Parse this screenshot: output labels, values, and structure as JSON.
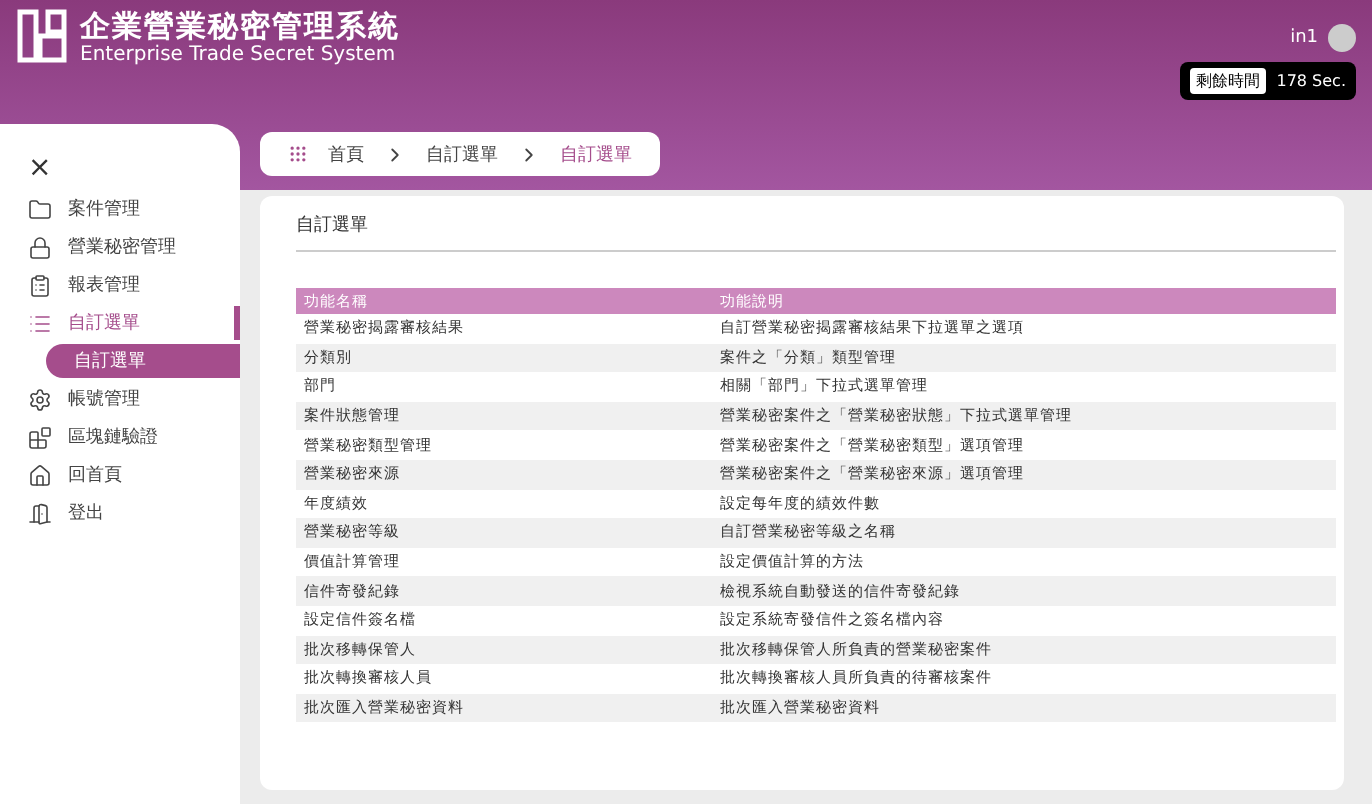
{
  "brand": {
    "title": "企業營業秘密管理系統",
    "subtitle": "Enterprise Trade Secret System"
  },
  "user": {
    "name": "in1",
    "timer_label": "剩餘時間",
    "timer_value": "178 Sec."
  },
  "sidebar": {
    "close": "×",
    "items": [
      {
        "label": "案件管理",
        "selected": false
      },
      {
        "label": "營業秘密管理",
        "selected": false
      },
      {
        "label": "報表管理",
        "selected": false
      },
      {
        "label": "自訂選單",
        "selected": true,
        "children": [
          {
            "label": "自訂選單",
            "selected": true
          }
        ]
      },
      {
        "label": "帳號管理",
        "selected": false
      },
      {
        "label": "區塊鏈驗證",
        "selected": false
      },
      {
        "label": "回首頁",
        "selected": false
      },
      {
        "label": "登出",
        "selected": false
      }
    ]
  },
  "breadcrumb": [
    {
      "label": "首頁",
      "selected": false
    },
    {
      "label": "自訂選單",
      "selected": false
    },
    {
      "label": "自訂選單",
      "selected": true
    }
  ],
  "panel": {
    "title": "自訂選單"
  },
  "table": {
    "columns": [
      "功能名稱",
      "功能說明"
    ],
    "rows": [
      [
        "營業秘密揭露審核結果",
        "自訂營業秘密揭露審核結果下拉選單之選項"
      ],
      [
        "分類別",
        "案件之「分類」類型管理"
      ],
      [
        "部門",
        "相關「部門」下拉式選單管理"
      ],
      [
        "案件狀態管理",
        "營業秘密案件之「營業秘密狀態」下拉式選單管理"
      ],
      [
        "營業秘密類型管理",
        "營業秘密案件之「營業秘密類型」選項管理"
      ],
      [
        "營業秘密來源",
        "營業秘密案件之「營業秘密來源」選項管理"
      ],
      [
        "年度績效",
        "設定每年度的績效件數"
      ],
      [
        "營業秘密等級",
        "自訂營業秘密等級之名稱"
      ],
      [
        "價值計算管理",
        "設定價值計算的方法"
      ],
      [
        "信件寄發紀錄",
        "檢視系統自動發送的信件寄發紀錄"
      ],
      [
        "設定信件簽名檔",
        "設定系統寄發信件之簽名檔內容"
      ],
      [
        "批次移轉保管人",
        "批次移轉保管人所負責的營業秘密案件"
      ],
      [
        "批次轉換審核人員",
        "批次轉換審核人員所負責的待審核案件"
      ],
      [
        "批次匯入營業秘密資料",
        "批次匯入營業秘密資料"
      ]
    ]
  }
}
